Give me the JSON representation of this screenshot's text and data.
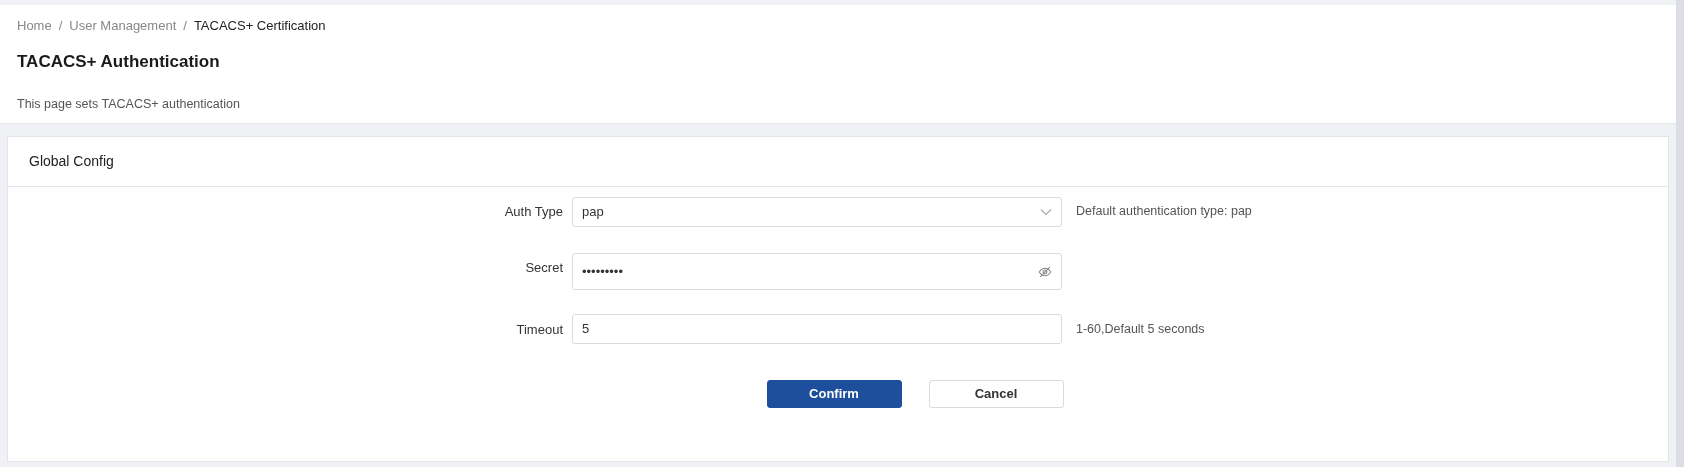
{
  "breadcrumb": [
    {
      "label": "Home",
      "current": false
    },
    {
      "label": "User Management",
      "current": false
    },
    {
      "label": "TACACS+ Certification",
      "current": true
    }
  ],
  "breadcrumb_separator": "/",
  "page": {
    "title": "TACACS+ Authentication",
    "description": "This page sets TACACS+ authentication"
  },
  "card": {
    "title": "Global Config",
    "fields": [
      {
        "kind": "select",
        "label": "Auth Type",
        "value": "pap",
        "hint": "Default authentication type: pap"
      },
      {
        "kind": "password",
        "label": "Secret",
        "value": "•••••••••"
      },
      {
        "kind": "text",
        "label": "Timeout",
        "value": "5",
        "hint": "1-60,Default 5 seconds"
      }
    ],
    "buttons": [
      {
        "label": "Confirm",
        "kind": "primary"
      },
      {
        "label": "Cancel",
        "kind": "secondary"
      }
    ]
  }
}
